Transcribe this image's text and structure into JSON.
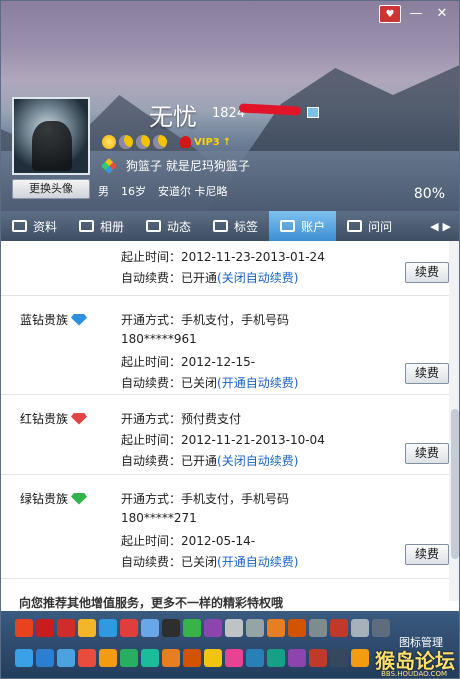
{
  "profile": {
    "nickname": "无忧",
    "qq_number": "1824",
    "signature_label": "狗篮子 就是尼玛狗篮子",
    "gender": "男",
    "age": "16岁",
    "location": "安道尔 卡尼略",
    "completion": "80%",
    "vip_label": "VIP3",
    "change_avatar": "更换头像"
  },
  "tabs": [
    {
      "label": "资料",
      "icon": "id-card-icon"
    },
    {
      "label": "相册",
      "icon": "album-icon"
    },
    {
      "label": "动态",
      "icon": "feed-icon"
    },
    {
      "label": "标签",
      "icon": "bookmark-icon"
    },
    {
      "label": "账户",
      "icon": "wallet-icon",
      "active": true
    },
    {
      "label": "问问",
      "icon": "question-icon"
    }
  ],
  "account": {
    "sections": [
      {
        "lines": [
          {
            "label": "起止时间：",
            "value": "2012-11-23-2013-01-24"
          },
          {
            "label": "自动续费：",
            "value": "已开通",
            "link": "(关闭自动续费)"
          }
        ],
        "renew": "续费"
      },
      {
        "title": "蓝钻贵族",
        "lines": [
          {
            "label": "开通方式：",
            "value": "手机支付，手机号码"
          },
          {
            "label": "",
            "value": "180*****961"
          },
          {
            "label": "起止时间：",
            "value": "2012-12-15-"
          },
          {
            "label": "自动续费：",
            "value": "已关闭",
            "link": "(开通自动续费)"
          }
        ],
        "renew": "续费"
      },
      {
        "title": "红钻贵族",
        "lines": [
          {
            "label": "开通方式：",
            "value": "预付费支付"
          },
          {
            "label": "起止时间：",
            "value": "2012-11-21-2013-10-04"
          },
          {
            "label": "自动续费：",
            "value": "已开通",
            "link": "(关闭自动续费)"
          }
        ],
        "renew": "续费"
      },
      {
        "title": "绿钻贵族",
        "lines": [
          {
            "label": "开通方式：",
            "value": "手机支付，手机号码"
          },
          {
            "label": "",
            "value": "180*****271"
          },
          {
            "label": "起止时间：",
            "value": "2012-05-14-"
          },
          {
            "label": "自动续费：",
            "value": "已关闭",
            "link": "(开通自动续费)"
          }
        ],
        "renew": "续费"
      }
    ],
    "promo": "向您推荐其他增值服务，更多不一样的精彩特权哦"
  },
  "dock": {
    "manage_label": "图标管理",
    "watermark": "猴岛论坛",
    "watermark_sub": "BBS.HOUDAO.COM"
  }
}
